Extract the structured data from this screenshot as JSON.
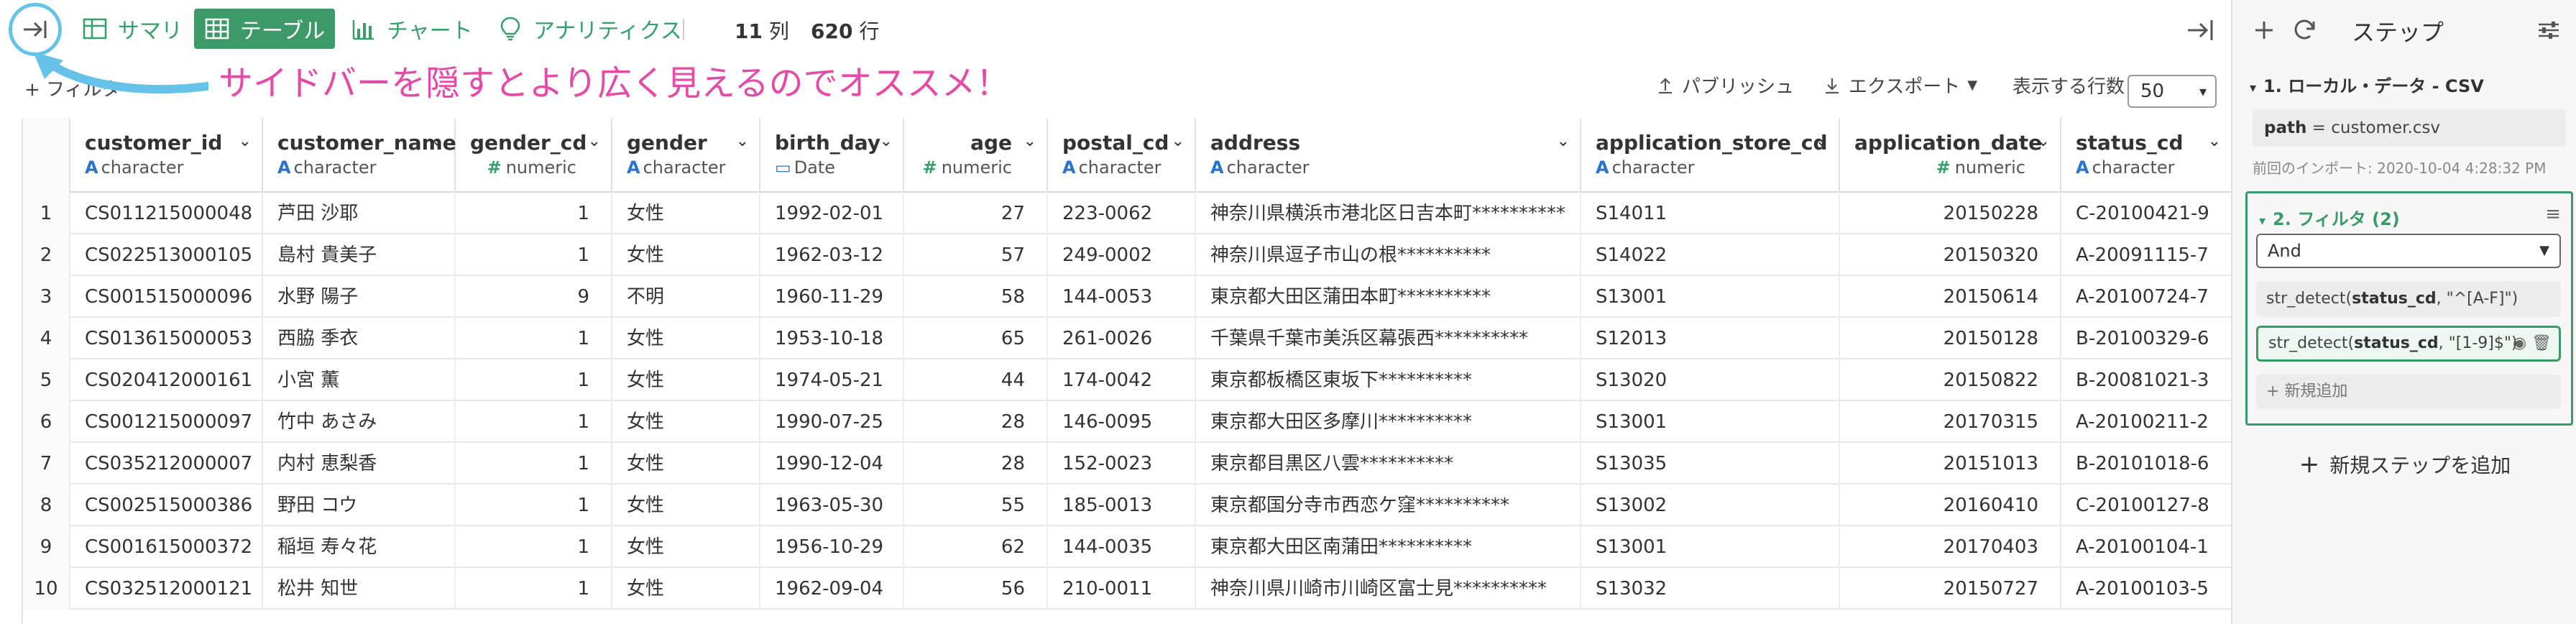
{
  "toolbar": {
    "tabs": [
      {
        "id": "summary",
        "label": "サマリ",
        "active": false
      },
      {
        "id": "table",
        "label": "テーブル",
        "active": true
      },
      {
        "id": "chart",
        "label": "チャート",
        "active": false
      },
      {
        "id": "analytics",
        "label": "アナリティクス",
        "active": false
      }
    ],
    "columns_count": "11",
    "columns_unit": "列",
    "rows_count": "620",
    "rows_unit": "行"
  },
  "subbar": {
    "filter_label": "+ フィルタ",
    "annotation": "サイドバーを隠すとより広く見えるのでオススメ！",
    "publish_label": "パブリッシュ",
    "export_label": "エクスポート",
    "rows_per_page_label": "表示する行数",
    "rows_per_page_value": "50"
  },
  "table": {
    "columns": [
      {
        "name": "customer_id",
        "type": "character",
        "kind": "A"
      },
      {
        "name": "customer_name",
        "type": "character",
        "kind": "A"
      },
      {
        "name": "gender_cd",
        "type": "numeric",
        "kind": "#"
      },
      {
        "name": "gender",
        "type": "character",
        "kind": "A"
      },
      {
        "name": "birth_day",
        "type": "Date",
        "kind": "date"
      },
      {
        "name": "age",
        "type": "numeric",
        "kind": "#"
      },
      {
        "name": "postal_cd",
        "type": "character",
        "kind": "A"
      },
      {
        "name": "address",
        "type": "character",
        "kind": "A"
      },
      {
        "name": "application_store_cd",
        "type": "character",
        "kind": "A"
      },
      {
        "name": "application_date",
        "type": "numeric",
        "kind": "#"
      },
      {
        "name": "status_cd",
        "type": "character",
        "kind": "A"
      }
    ],
    "rows": [
      [
        "1",
        "CS011215000048",
        "芦田 沙耶",
        "1",
        "女性",
        "1992-02-01",
        "27",
        "223-0062",
        "神奈川県横浜市港北区日吉本町**********",
        "S14011",
        "20150228",
        "C-20100421-9"
      ],
      [
        "2",
        "CS022513000105",
        "島村 貴美子",
        "1",
        "女性",
        "1962-03-12",
        "57",
        "249-0002",
        "神奈川県逗子市山の根**********",
        "S14022",
        "20150320",
        "A-20091115-7"
      ],
      [
        "3",
        "CS001515000096",
        "水野 陽子",
        "9",
        "不明",
        "1960-11-29",
        "58",
        "144-0053",
        "東京都大田区蒲田本町**********",
        "S13001",
        "20150614",
        "A-20100724-7"
      ],
      [
        "4",
        "CS013615000053",
        "西脇 季衣",
        "1",
        "女性",
        "1953-10-18",
        "65",
        "261-0026",
        "千葉県千葉市美浜区幕張西**********",
        "S12013",
        "20150128",
        "B-20100329-6"
      ],
      [
        "5",
        "CS020412000161",
        "小宮 薫",
        "1",
        "女性",
        "1974-05-21",
        "44",
        "174-0042",
        "東京都板橋区東坂下**********",
        "S13020",
        "20150822",
        "B-20081021-3"
      ],
      [
        "6",
        "CS001215000097",
        "竹中 あさみ",
        "1",
        "女性",
        "1990-07-25",
        "28",
        "146-0095",
        "東京都大田区多摩川**********",
        "S13001",
        "20170315",
        "A-20100211-2"
      ],
      [
        "7",
        "CS035212000007",
        "内村 恵梨香",
        "1",
        "女性",
        "1990-12-04",
        "28",
        "152-0023",
        "東京都目黒区八雲**********",
        "S13035",
        "20151013",
        "B-20101018-6"
      ],
      [
        "8",
        "CS002515000386",
        "野田 コウ",
        "1",
        "女性",
        "1963-05-30",
        "55",
        "185-0013",
        "東京都国分寺市西恋ケ窪**********",
        "S13002",
        "20160410",
        "C-20100127-8"
      ],
      [
        "9",
        "CS001615000372",
        "稲垣 寿々花",
        "1",
        "女性",
        "1956-10-29",
        "62",
        "144-0035",
        "東京都大田区南蒲田**********",
        "S13001",
        "20170403",
        "A-20100104-1"
      ],
      [
        "10",
        "CS032512000121",
        "松井 知世",
        "1",
        "女性",
        "1962-09-04",
        "56",
        "210-0011",
        "神奈川県川崎市川崎区富士見**********",
        "S13032",
        "20150727",
        "A-20100103-5"
      ]
    ]
  },
  "sidebar": {
    "title": "ステップ",
    "step1": {
      "label": "1. ローカル・データ - CSV",
      "param_key": "path",
      "param_value": " = customer.csv",
      "import_note": "前回のインポート: 2020-10-04 4:28:32 PM"
    },
    "step2": {
      "label": "2. フィルタ (2)",
      "logic": "And",
      "conditions": [
        {
          "fn": "str_detect(",
          "col": "status_cd",
          "arg": ", \"^[A-F]\")"
        },
        {
          "fn": "str_detect(",
          "col": "status_cd",
          "arg": ", \"[1-9]$\")"
        }
      ],
      "add_new": "+ 新規追加"
    },
    "add_step": "新規ステップを追加"
  }
}
